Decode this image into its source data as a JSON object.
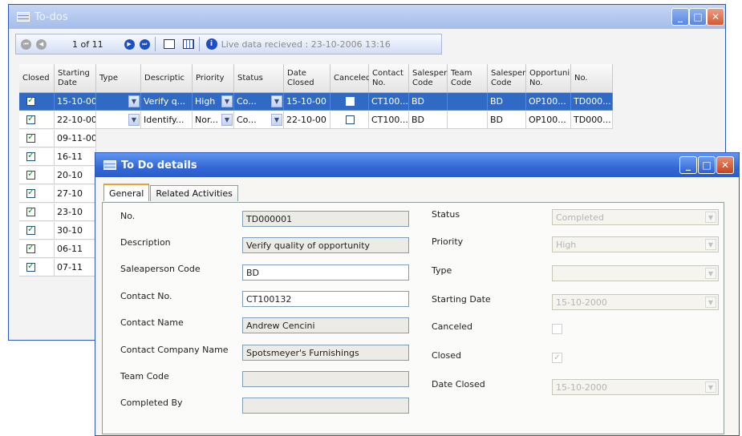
{
  "todos_window": {
    "title": "To-dos",
    "toolbar": {
      "record_position": "1 of 11",
      "status_text": "Live data recieved : 23-10-2006 13:16"
    },
    "columns": [
      "Closed",
      "Starting Date",
      "Type",
      "Descriptic",
      "Priority",
      "Status",
      "Date Closed",
      "Canceled",
      "Contact No.",
      "Salespers Code",
      "Team Code",
      "Salespers Code",
      "Opportuni No.",
      "No."
    ],
    "rows": [
      {
        "closed": true,
        "starting_date": "15-10-00",
        "type": "",
        "description": "Verify q...",
        "priority": "High",
        "status": "Co...",
        "date_closed": "15-10-00",
        "canceled": false,
        "contact_no": "CT100...",
        "salesperson_code": "BD",
        "team_code": "",
        "salesperson_code2": "BD",
        "opportunity_no": "OP100...",
        "no": "TD000...",
        "selected": true
      },
      {
        "closed": true,
        "starting_date": "22-10-00",
        "type": "",
        "description": "Identify...",
        "priority": "Nor...",
        "status": "Co...",
        "date_closed": "22-10-00",
        "canceled": false,
        "contact_no": "CT100...",
        "salesperson_code": "BD",
        "team_code": "",
        "salesperson_code2": "BD",
        "opportunity_no": "OP100...",
        "no": "TD000..."
      },
      {
        "closed": true,
        "starting_date": "09-11-00"
      },
      {
        "closed": true,
        "starting_date": "16-11"
      },
      {
        "closed": true,
        "starting_date": "20-10"
      },
      {
        "closed": true,
        "starting_date": "27-10"
      },
      {
        "closed": true,
        "starting_date": "23-10"
      },
      {
        "closed": true,
        "starting_date": "30-10"
      },
      {
        "closed": true,
        "starting_date": "06-11"
      },
      {
        "closed": true,
        "starting_date": "07-11"
      }
    ]
  },
  "details_window": {
    "title": "To Do details",
    "tabs": [
      "General",
      "Related Activities"
    ],
    "left_fields": [
      {
        "label": "No.",
        "value": "TD000001"
      },
      {
        "label": "Description",
        "value": "Verify quality of opportunity"
      },
      {
        "label": "Saleaperson Code",
        "value": "BD"
      },
      {
        "label": "Contact No.",
        "value": "CT100132"
      },
      {
        "label": "Contact Name",
        "value": "Andrew Cencini"
      },
      {
        "label": "Contact Company Name",
        "value": "Spotsmeyer's Furnishings"
      },
      {
        "label": "Team Code",
        "value": ""
      },
      {
        "label": "Completed By",
        "value": ""
      }
    ],
    "right_fields": {
      "status_label": "Status",
      "status_value": "Completed",
      "priority_label": "Priority",
      "priority_value": "High",
      "type_label": "Type",
      "type_value": "",
      "starting_date_label": "Starting Date",
      "starting_date_value": "15-10-2000",
      "canceled_label": "Canceled",
      "canceled_value": false,
      "closed_label": "Closed",
      "closed_value": true,
      "date_closed_label": "Date Closed",
      "date_closed_value": "15-10-2000"
    }
  },
  "colors": {
    "title_active": "#3367d6",
    "title_inactive": "#a5bde9",
    "selection": "#316ac5",
    "close_button": "#c8431f"
  }
}
